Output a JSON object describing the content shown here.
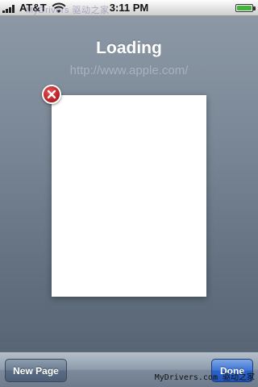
{
  "status_bar": {
    "carrier": "AT&T",
    "time": "3:11 PM",
    "watermark": "MyDrivers 驱动之家"
  },
  "page": {
    "title": "Loading",
    "url": "http://www.apple.com/"
  },
  "toolbar": {
    "new_page_label": "New Page",
    "done_label": "Done"
  },
  "watermark_bottom": "MyDrivers.com 驱动之家",
  "colors": {
    "close_badge": "#c0272d",
    "done_button": "#2b63cb",
    "toolbar": "#8d9bab"
  },
  "icons": {
    "signal": "signal-bars-icon",
    "wifi": "wifi-icon",
    "battery": "battery-icon",
    "close": "close-icon"
  }
}
